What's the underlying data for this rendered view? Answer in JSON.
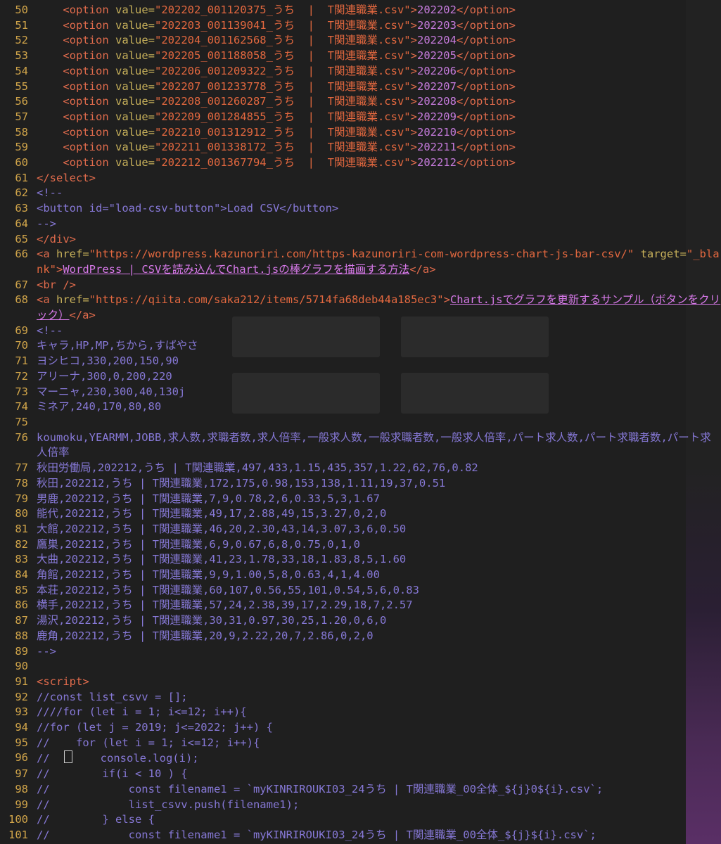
{
  "colors": {
    "background": "#1f1f1f",
    "line_number": "#d1a54a",
    "tag": "#e06b4c",
    "attribute": "#c7b05a",
    "string": "#e3683f",
    "text": "#c67bdc",
    "comment": "#8678d6"
  },
  "lines": [
    {
      "n": "50",
      "t": "option",
      "v": "202202_001120375_うち  |  T関連職業.csv",
      "x": "202202"
    },
    {
      "n": "51",
      "t": "option",
      "v": "202203_001139041_うち  |  T関連職業.csv",
      "x": "202203"
    },
    {
      "n": "52",
      "t": "option",
      "v": "202204_001162568_うち  |  T関連職業.csv",
      "x": "202204"
    },
    {
      "n": "53",
      "t": "option",
      "v": "202205_001188058_うち  |  T関連職業.csv",
      "x": "202205"
    },
    {
      "n": "54",
      "t": "option",
      "v": "202206_001209322_うち  |  T関連職業.csv",
      "x": "202206"
    },
    {
      "n": "55",
      "t": "option",
      "v": "202207_001233778_うち  |  T関連職業.csv",
      "x": "202207"
    },
    {
      "n": "56",
      "t": "option",
      "v": "202208_001260287_うち  |  T関連職業.csv",
      "x": "202208"
    },
    {
      "n": "57",
      "t": "option",
      "v": "202209_001284855_うち  |  T関連職業.csv",
      "x": "202209"
    },
    {
      "n": "58",
      "t": "option",
      "v": "202210_001312912_うち  |  T関連職業.csv",
      "x": "202210"
    },
    {
      "n": "59",
      "t": "option",
      "v": "202211_001338172_うち  |  T関連職業.csv",
      "x": "202211"
    },
    {
      "n": "60",
      "t": "option",
      "v": "202212_001367794_うち  |  T関連職業.csv",
      "x": "202212"
    },
    {
      "n": "61",
      "t": "close",
      "s": "</select>"
    },
    {
      "n": "62",
      "t": "com",
      "s": "<!--"
    },
    {
      "n": "63",
      "t": "com",
      "s": "<button id=\"load-csv-button\">Load CSV</button>"
    },
    {
      "n": "64",
      "t": "com",
      "s": "-->"
    },
    {
      "n": "65",
      "t": "close",
      "s": "</div>"
    },
    {
      "n": "66",
      "t": "link",
      "href": "https://wordpress.kazunoriri.com/https-kazunoriri-com-wordpress-chart-js-bar-csv/",
      "x": "WordPress | CSVを読み込んでChart.jsの棒グラフを描画する方法"
    },
    {
      "n": "67",
      "t": "close",
      "s": "<br />"
    },
    {
      "n": "68",
      "t": "link2",
      "href": "https://qiita.com/saka212/items/5714fa68deb44a185ec3",
      "x": "Chart.jsでグラフを更新するサンプル（ボタンをクリック）"
    },
    {
      "n": "69",
      "t": "com",
      "s": "<!--"
    },
    {
      "n": "70",
      "t": "com",
      "s": "キャラ,HP,MP,ちから,すばやさ"
    },
    {
      "n": "71",
      "t": "com",
      "s": "ヨシヒコ,330,200,150,90"
    },
    {
      "n": "72",
      "t": "com",
      "s": "アリーナ,300,0,200,220"
    },
    {
      "n": "73",
      "t": "com",
      "s": "マーニャ,230,300,40,130j"
    },
    {
      "n": "74",
      "t": "com",
      "s": "ミネア,240,170,80,80"
    },
    {
      "n": "75",
      "t": "com",
      "s": ""
    },
    {
      "n": "76",
      "t": "comwrap",
      "s": "koumoku,YEARMM,JOBB,求人数,求職者数,求人倍率,一般求人数,一般求職者数,一般求人倍率,パート求人数,パート求職者数,パート求人倍率"
    },
    {
      "n": "77",
      "t": "com",
      "s": "秋田労働局,202212,うち | T関連職業,497,433,1.15,435,357,1.22,62,76,0.82"
    },
    {
      "n": "78",
      "t": "com",
      "s": "秋田,202212,うち | T関連職業,172,175,0.98,153,138,1.11,19,37,0.51"
    },
    {
      "n": "79",
      "t": "com",
      "s": "男鹿,202212,うち | T関連職業,7,9,0.78,2,6,0.33,5,3,1.67"
    },
    {
      "n": "80",
      "t": "com",
      "s": "能代,202212,うち | T関連職業,49,17,2.88,49,15,3.27,0,2,0"
    },
    {
      "n": "81",
      "t": "com",
      "s": "大館,202212,うち | T関連職業,46,20,2.30,43,14,3.07,3,6,0.50"
    },
    {
      "n": "82",
      "t": "com",
      "s": "鷹巣,202212,うち | T関連職業,6,9,0.67,6,8,0.75,0,1,0"
    },
    {
      "n": "83",
      "t": "com",
      "s": "大曲,202212,うち | T関連職業,41,23,1.78,33,18,1.83,8,5,1.60"
    },
    {
      "n": "84",
      "t": "com",
      "s": "角館,202212,うち | T関連職業,9,9,1.00,5,8,0.63,4,1,4.00"
    },
    {
      "n": "85",
      "t": "com",
      "s": "本荘,202212,うち | T関連職業,60,107,0.56,55,101,0.54,5,6,0.83"
    },
    {
      "n": "86",
      "t": "com",
      "s": "横手,202212,うち | T関連職業,57,24,2.38,39,17,2.29,18,7,2.57"
    },
    {
      "n": "87",
      "t": "com",
      "s": "湯沢,202212,うち | T関連職業,30,31,0.97,30,25,1.20,0,6,0"
    },
    {
      "n": "88",
      "t": "com",
      "s": "鹿角,202212,うち | T関連職業,20,9,2.22,20,7,2.86,0,2,0"
    },
    {
      "n": "89",
      "t": "com",
      "s": "-->"
    },
    {
      "n": "90",
      "t": "com",
      "s": ""
    },
    {
      "n": "91",
      "t": "close",
      "s": "<script>"
    },
    {
      "n": "92",
      "t": "jscom",
      "s": "//const list_csvv = [];"
    },
    {
      "n": "93",
      "t": "jscom",
      "s": "////for (let i = 1; i<=12; i++){"
    },
    {
      "n": "94",
      "t": "jscom",
      "s": "//for (let j = 2019; j<=2022; j++) {"
    },
    {
      "n": "95",
      "t": "jscom",
      "s": "//    for (let i = 1; i<=12; i++){"
    },
    {
      "n": "96",
      "t": "cursor",
      "a": "//  ",
      "b": "    console.log(i);"
    },
    {
      "n": "97",
      "t": "jscom",
      "s": "//        if(i < 10 ) {"
    },
    {
      "n": "98",
      "t": "jscom",
      "s": "//            const filename1 = `myKINRIROUKI03_24うち | T関連職業_00全体_${j}0${i}.csv`;"
    },
    {
      "n": "99",
      "t": "jscom",
      "s": "//            list_csvv.push(filename1);"
    },
    {
      "n": "100",
      "t": "jscom",
      "s": "//        } else {"
    },
    {
      "n": "101",
      "t": "jscom",
      "s": "//            const filename1 = `myKINRIROUKI03_24うち | T関連職業_00全体_${j}${i}.csv`;"
    }
  ]
}
